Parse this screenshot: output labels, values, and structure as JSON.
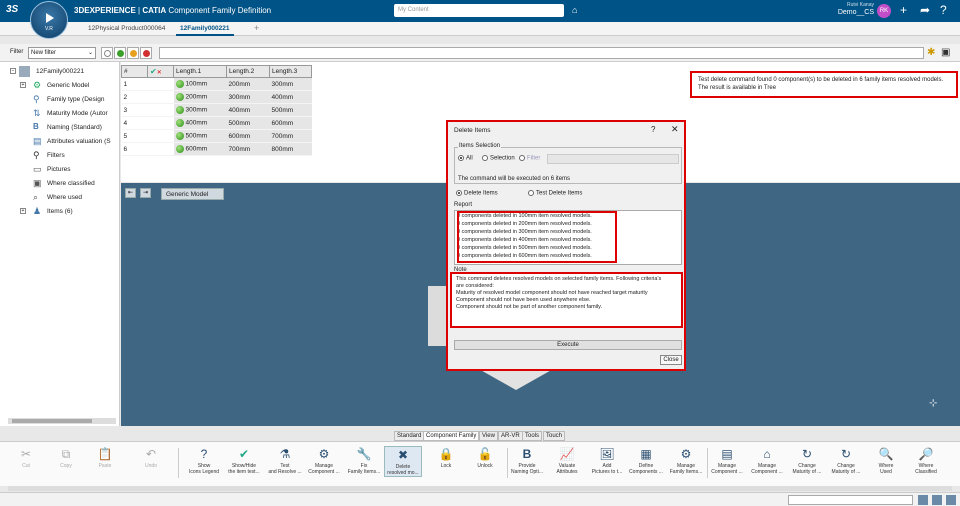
{
  "topbar": {
    "brand_logo": "3S",
    "compass_version": "V.R",
    "app_brand": "3DEXPERIENCE",
    "app_sep": " | ",
    "app_name": "CATIA",
    "app_module": "Component Family Definition",
    "search_placeholder": "My Content",
    "user_name": "Rutvi Kanay",
    "workspace": "Demo__CS",
    "avatar_initials": "RK"
  },
  "tabs": [
    {
      "label": "12Physical Product000064"
    },
    {
      "label": "12Family000221"
    }
  ],
  "filter": {
    "label": "Filter",
    "value": "New filter"
  },
  "tree": {
    "root": "12Family000221",
    "items": [
      {
        "label": "Generic Model"
      },
      {
        "label": "Family type (Design"
      },
      {
        "label": "Maturity Mode (Autor"
      },
      {
        "label": "Naming (Standard)"
      },
      {
        "label": "Attributes valuation (S"
      },
      {
        "label": "Filters"
      },
      {
        "label": "Pictures"
      },
      {
        "label": "Where classified"
      },
      {
        "label": "Where used"
      },
      {
        "label": "Items (6)"
      }
    ]
  },
  "table": {
    "headers": [
      "#",
      "",
      "Length.1",
      "Length.2",
      "Length.3"
    ],
    "rows": [
      {
        "n": "1",
        "l1": "100mm",
        "l2": "200mm",
        "l3": "300mm"
      },
      {
        "n": "2",
        "l1": "200mm",
        "l2": "300mm",
        "l3": "400mm"
      },
      {
        "n": "3",
        "l1": "300mm",
        "l2": "400mm",
        "l3": "500mm"
      },
      {
        "n": "4",
        "l1": "400mm",
        "l2": "500mm",
        "l3": "600mm"
      },
      {
        "n": "5",
        "l1": "500mm",
        "l2": "600mm",
        "l3": "700mm"
      },
      {
        "n": "6",
        "l1": "600mm",
        "l2": "700mm",
        "l3": "800mm"
      }
    ]
  },
  "notice": {
    "line1": "Test delete command found 0 component(s) to be deleted in 6 family items resolved models.",
    "line2": "The result is available in Tree"
  },
  "viewport": {
    "label": "Generic Model"
  },
  "dialog": {
    "title": "Delete Items",
    "help": "?",
    "close": "✕",
    "items_selection_title": "Items Selection",
    "opt_all": "All",
    "opt_selection": "Selection",
    "opt_filter": "Filter",
    "executed_on": "The command will be executed on 6 items",
    "opt_delete": "Delete Items",
    "opt_test_delete": "Test Delete Items",
    "report_title": "Report",
    "report_lines": [
      "0 components deleted in 100mm item resolved models.",
      "0 components deleted in 200mm item resolved models.",
      "0 components deleted in 300mm item resolved models.",
      "0 components deleted in 400mm item resolved models.",
      "0 components deleted in 500mm item resolved models.",
      "0 components deleted in 600mm item resolved models."
    ],
    "note_title": "Note",
    "note_lines": [
      "This command deletes resolved models on selected family items. Following criteria's",
      "are considered:",
      "Maturity of resolved model component should not have reached target maturity",
      "Component should not have been used anywhere else.",
      "Component should not be part of another component family."
    ],
    "execute": "Execute",
    "close_button": "Close"
  },
  "ribbon_tabs": [
    {
      "label": "Standard"
    },
    {
      "label": "Component Family"
    },
    {
      "label": "View"
    },
    {
      "label": "AR-VR"
    },
    {
      "label": "Tools"
    },
    {
      "label": "Touch"
    }
  ],
  "actions": [
    {
      "l1": "Cut",
      "l2": "",
      "icon": "✂",
      "disabled": true
    },
    {
      "l1": "Copy",
      "l2": "",
      "icon": "⧉",
      "disabled": true
    },
    {
      "l1": "Paste",
      "l2": "",
      "icon": "📋",
      "disabled": true
    },
    {
      "l1": "Undo",
      "l2": "",
      "icon": "↶",
      "disabled": true
    },
    {
      "l1": "Show",
      "l2": "Icons Legend",
      "icon": "?",
      "disabled": false
    },
    {
      "l1": "Show/Hide",
      "l2": "the item test...",
      "icon": "✔",
      "disabled": false
    },
    {
      "l1": "Test",
      "l2": "and Resolve ...",
      "icon": "⚗",
      "disabled": false
    },
    {
      "l1": "Manage",
      "l2": "Component ...",
      "icon": "⚙",
      "disabled": false
    },
    {
      "l1": "Fix",
      "l2": "Family Items...",
      "icon": "🔧",
      "disabled": false
    },
    {
      "l1": "Delete",
      "l2": "resolved mo...",
      "icon": "✖",
      "disabled": false
    },
    {
      "l1": "Lock",
      "l2": "",
      "icon": "🔒",
      "disabled": false
    },
    {
      "l1": "Unlock",
      "l2": "",
      "icon": "🔓",
      "disabled": false
    },
    {
      "l1": "Provide",
      "l2": "Naming Opti...",
      "icon": "B",
      "disabled": false
    },
    {
      "l1": "Valuate",
      "l2": "Attributes",
      "icon": "📈",
      "disabled": false
    },
    {
      "l1": "Add",
      "l2": "Pictures to t...",
      "icon": "🖼",
      "disabled": false
    },
    {
      "l1": "Define",
      "l2": "Components ...",
      "icon": "▦",
      "disabled": false
    },
    {
      "l1": "Manage",
      "l2": "Family Items...",
      "icon": "⚙",
      "disabled": false
    },
    {
      "l1": "Manage",
      "l2": "Component ...",
      "icon": "▤",
      "disabled": false
    },
    {
      "l1": "Manage",
      "l2": "Component ...",
      "icon": "⌂",
      "disabled": false
    },
    {
      "l1": "Change",
      "l2": "Maturity of ...",
      "icon": "↻",
      "disabled": false
    },
    {
      "l1": "Change",
      "l2": "Maturity of ...",
      "icon": "↻",
      "disabled": false
    },
    {
      "l1": "Where",
      "l2": "Used",
      "icon": "🔍",
      "disabled": false
    },
    {
      "l1": "Where",
      "l2": "Classified",
      "icon": "🔎",
      "disabled": false
    }
  ],
  "colors": {
    "topbar": "#005386",
    "highlight": "#dd0000",
    "viewport": "#3f6784"
  }
}
